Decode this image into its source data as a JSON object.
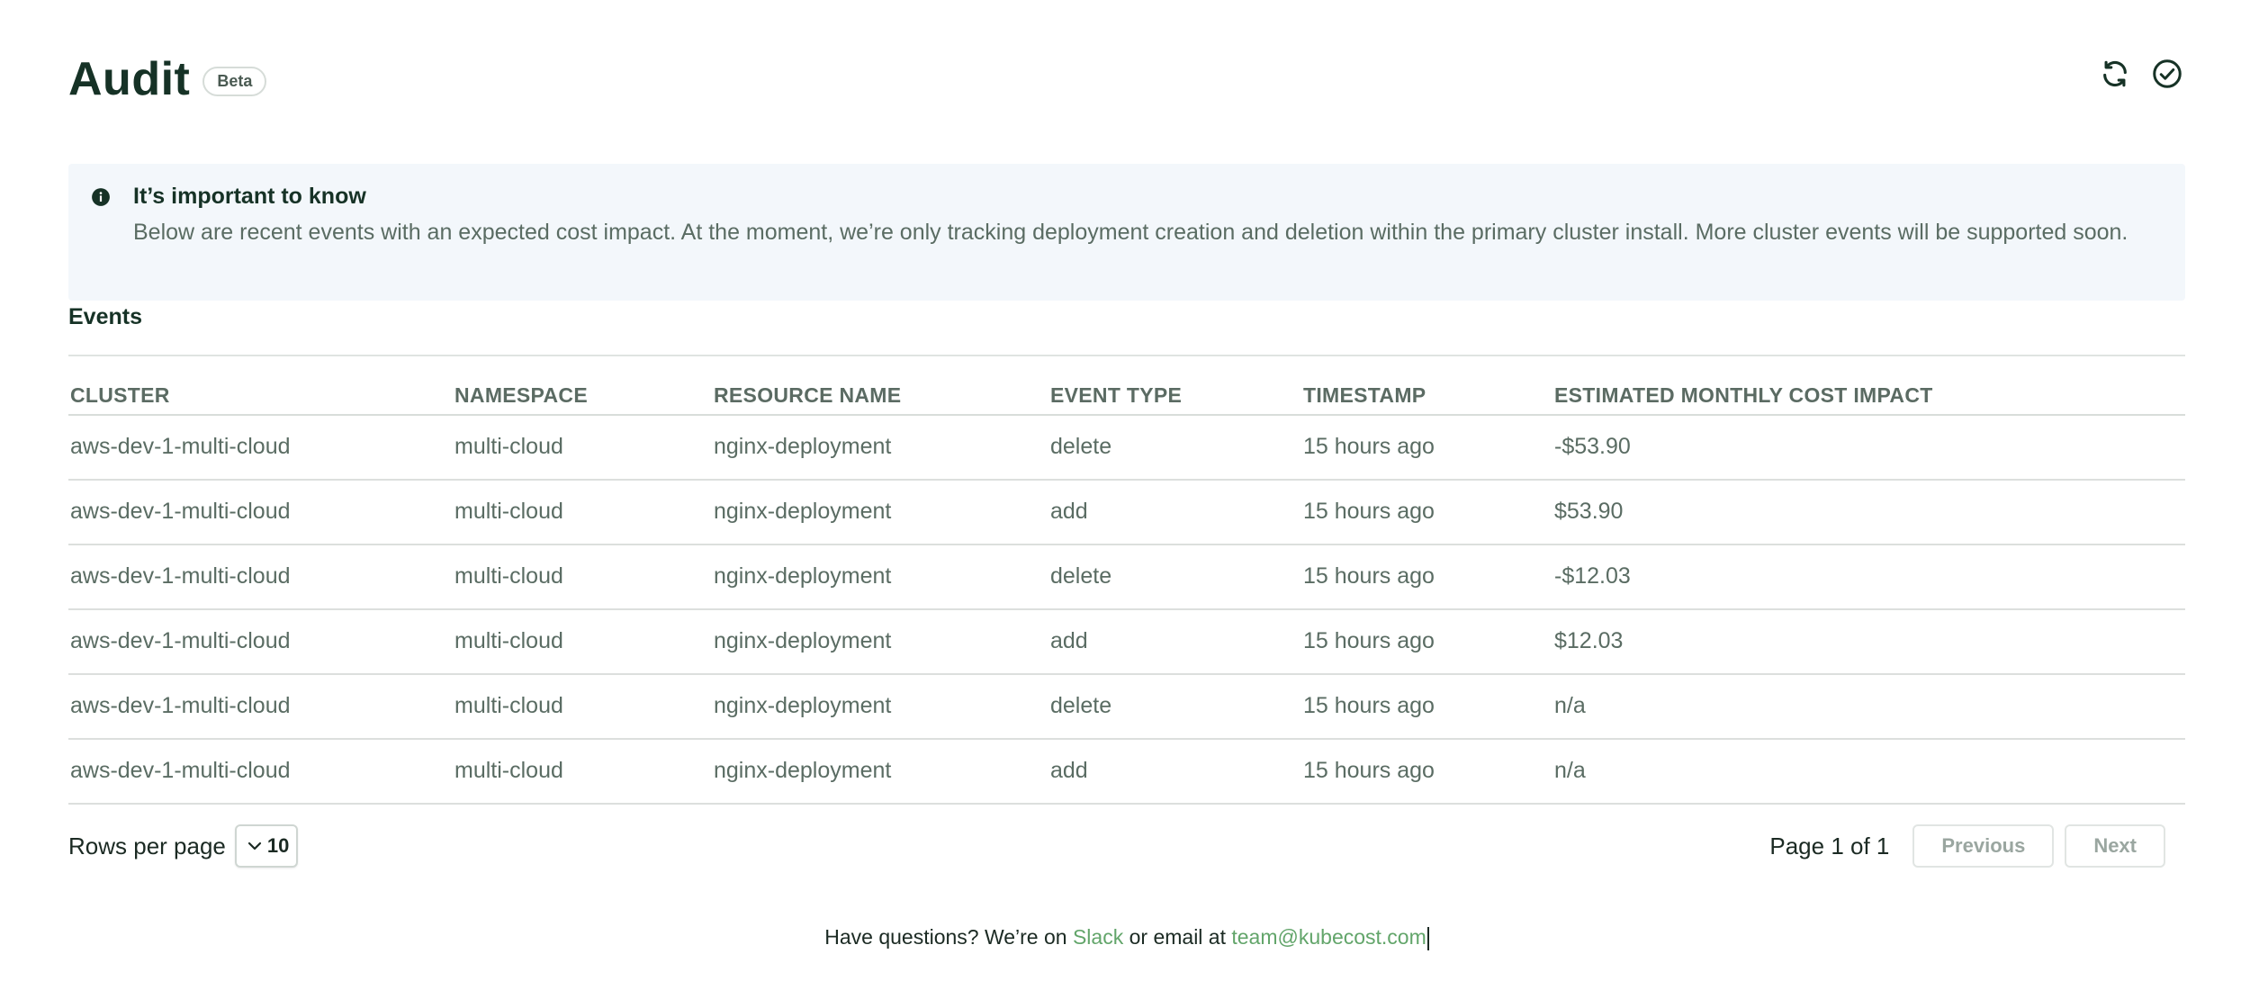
{
  "header": {
    "title": "Audit",
    "badge": "Beta",
    "actions": [
      {
        "name": "refresh",
        "icon": "refresh-icon"
      },
      {
        "name": "check",
        "icon": "check-circle-icon"
      }
    ]
  },
  "banner": {
    "icon": "info-icon",
    "title": "It’s important to know",
    "text": "Below are recent events with an expected cost impact. At the moment, we’re only tracking deployment creation and deletion within the primary cluster install. More cluster events will be supported soon."
  },
  "events": {
    "title": "Events",
    "columns": [
      "CLUSTER",
      "NAMESPACE",
      "RESOURCE NAME",
      "EVENT TYPE",
      "TIMESTAMP",
      "ESTIMATED MONTHLY COST IMPACT"
    ],
    "rows": [
      [
        "aws-dev-1-multi-cloud",
        "multi-cloud",
        "nginx-deployment",
        "delete",
        "15 hours ago",
        "-$53.90"
      ],
      [
        "aws-dev-1-multi-cloud",
        "multi-cloud",
        "nginx-deployment",
        "add",
        "15 hours ago",
        "$53.90"
      ],
      [
        "aws-dev-1-multi-cloud",
        "multi-cloud",
        "nginx-deployment",
        "delete",
        "15 hours ago",
        "-$12.03"
      ],
      [
        "aws-dev-1-multi-cloud",
        "multi-cloud",
        "nginx-deployment",
        "add",
        "15 hours ago",
        "$12.03"
      ],
      [
        "aws-dev-1-multi-cloud",
        "multi-cloud",
        "nginx-deployment",
        "delete",
        "15 hours ago",
        "n/a"
      ],
      [
        "aws-dev-1-multi-cloud",
        "multi-cloud",
        "nginx-deployment",
        "add",
        "15 hours ago",
        "n/a"
      ]
    ]
  },
  "pagination": {
    "rows_per_page_label": "Rows per page",
    "rows_per_page_value": "10",
    "page_info": "Page 1 of 1",
    "previous_label": "Previous",
    "next_label": "Next"
  },
  "footer": {
    "prefix": "Have questions? We’re on",
    "slack_link": "Slack",
    "middle": "or email at",
    "email_link": "team@kubecost.com"
  },
  "colors": {
    "brand_dark": "#163226",
    "link_green": "#62a56a",
    "banner_bg": "#f3f7fb"
  }
}
